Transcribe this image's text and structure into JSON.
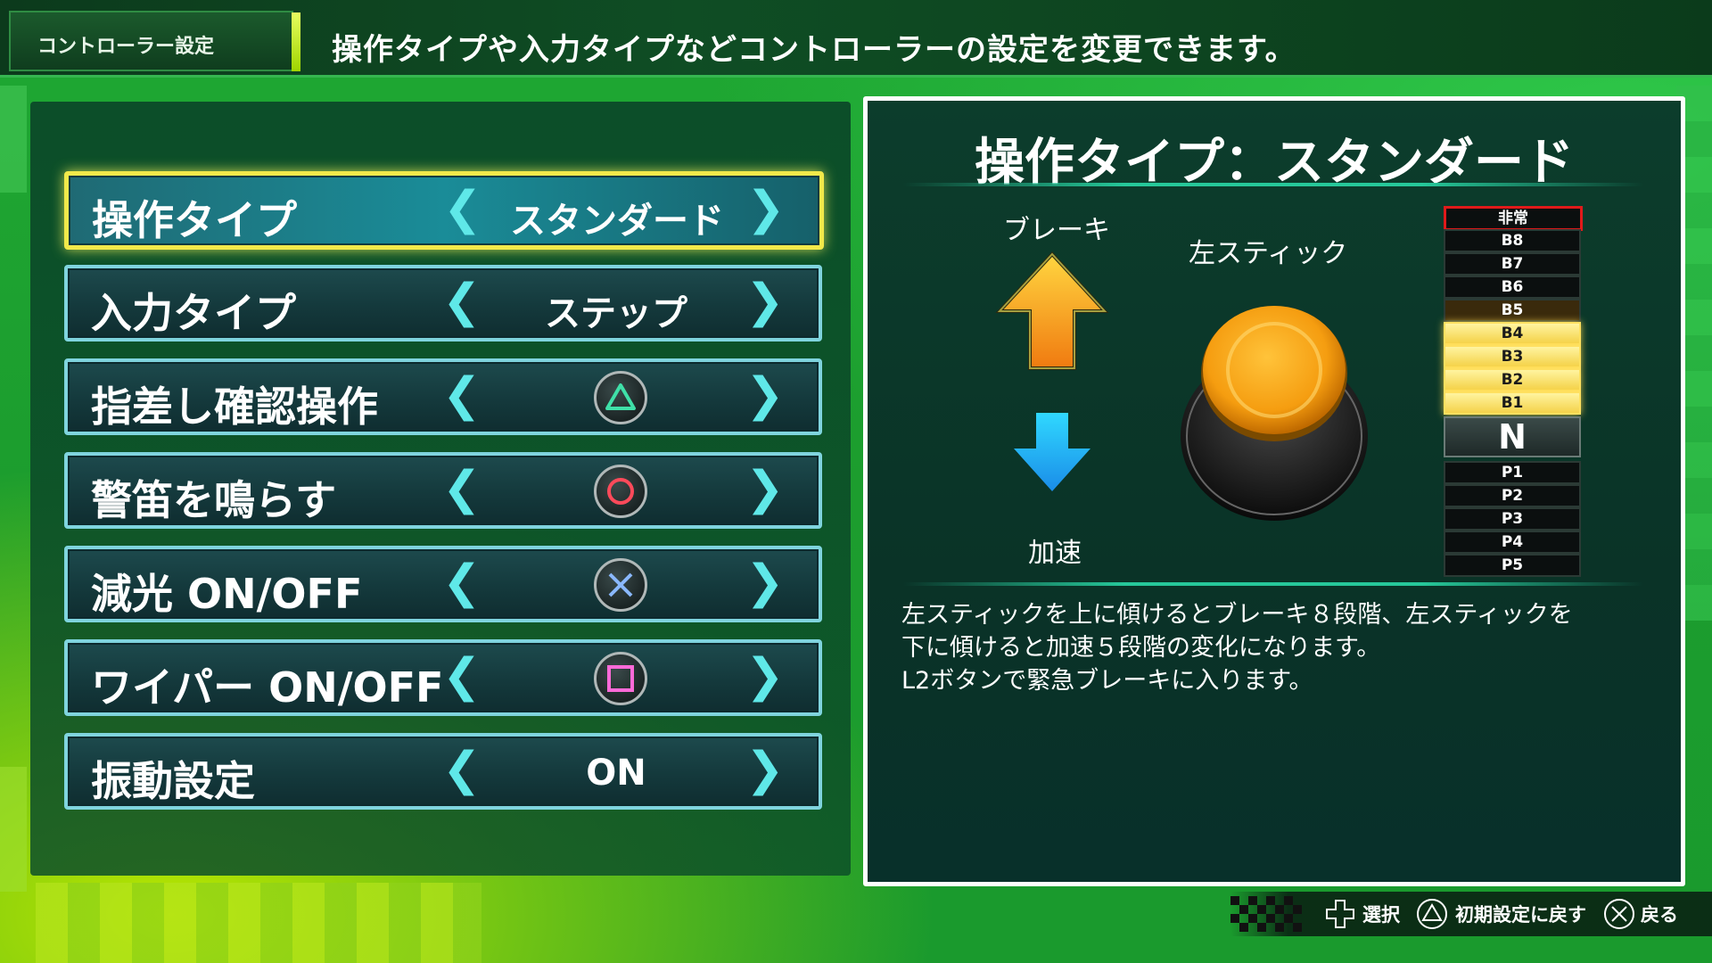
{
  "header": {
    "section": "コントローラー設定",
    "description": "操作タイプや入力タイプなどコントローラーの設定を変更できます。"
  },
  "settings": [
    {
      "label": "操作タイプ",
      "value": "スタンダード",
      "selected": true
    },
    {
      "label": "入力タイプ",
      "value": "ステップ"
    },
    {
      "label": "指差し確認操作",
      "button": "triangle-icon"
    },
    {
      "label": "警笛を鳴らす",
      "button": "circle-icon"
    },
    {
      "label": "減光 ON/OFF",
      "button": "cross-icon"
    },
    {
      "label": "ワイパー ON/OFF",
      "button": "square-icon"
    },
    {
      "label": "振動設定",
      "value": "ON"
    }
  ],
  "detail": {
    "title": "操作タイプ：スタンダード",
    "brake_label": "ブレーキ",
    "accel_label": "加速",
    "stick_label": "左スティック",
    "notches": [
      "非常",
      "B8",
      "B7",
      "B6",
      "B5",
      "B4",
      "B3",
      "B2",
      "B1",
      "N",
      "P1",
      "P2",
      "P3",
      "P4",
      "P5"
    ],
    "active_notches": [
      "B4",
      "B3",
      "B2",
      "B1"
    ],
    "description_lines": [
      "左スティックを上に傾けるとブレーキ８段階、左スティックを",
      "下に傾けると加速５段階の変化になります。",
      "L2ボタンで緊急ブレーキに入ります。"
    ]
  },
  "footer": {
    "select": "選択",
    "reset": "初期設定に戻す",
    "back": "戻る"
  },
  "colors": {
    "accent_yellow": "#f2e94a",
    "panel_border": "#7fd4de",
    "arrow_cyan": "#5fe8e8",
    "emergency_red": "#e01a1a"
  }
}
